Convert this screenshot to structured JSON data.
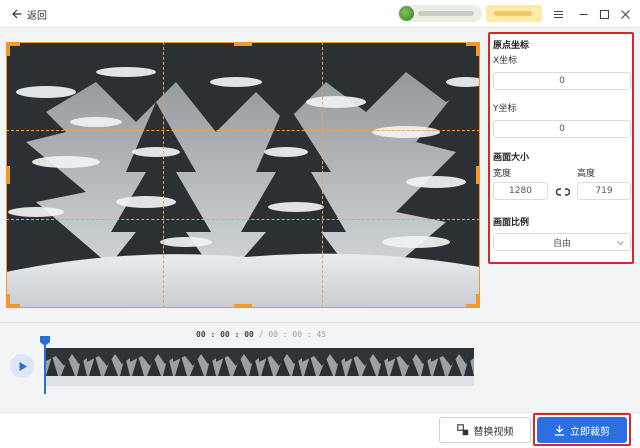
{
  "header": {
    "back_label": "返回"
  },
  "panel": {
    "origin_title": "原点坐标",
    "x_label": "X坐标",
    "x_value": "0",
    "y_label": "Y坐标",
    "y_value": "0",
    "size_title": "画面大小",
    "width_label": "宽度",
    "height_label": "高度",
    "width_value": "1280",
    "height_value": "719",
    "ratio_title": "画面比例",
    "ratio_value": "自由"
  },
  "timeline": {
    "time_hh": "00",
    "time_mm": "00",
    "time_ss": "00",
    "total": "00 : 00 : 45",
    "playhead_fraction": 0
  },
  "footer": {
    "replace_label": "替换视频",
    "crop_label": "立即裁剪"
  },
  "colors": {
    "accent": "#2b6fe0",
    "crop_frame": "#f19a2a",
    "highlight": "#d9262c"
  },
  "icons": [
    "back-arrow-icon",
    "menu-icon",
    "minimize-icon",
    "maximize-icon",
    "close-icon",
    "play-icon",
    "link-icon",
    "chevron-down-icon",
    "replace-icon",
    "download-icon"
  ]
}
